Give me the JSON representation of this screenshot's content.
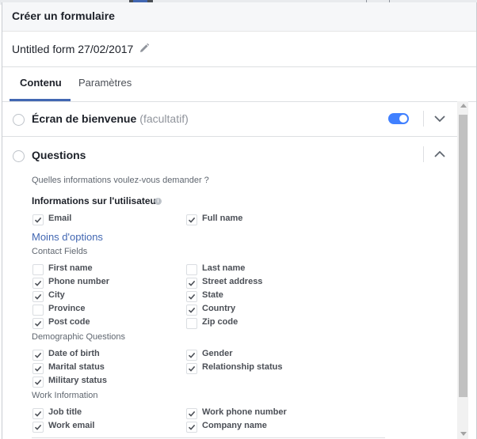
{
  "header": {
    "title": "Créer un formulaire"
  },
  "form": {
    "name": "Untitled form 27/02/2017"
  },
  "tabs": [
    {
      "label": "Contenu",
      "active": true
    },
    {
      "label": "Paramètres",
      "active": false
    }
  ],
  "welcome": {
    "title": "Écran de bienvenue",
    "optional": "(facultatif)",
    "toggle_on": true
  },
  "questions": {
    "title": "Questions",
    "prompt": "Quelles informations voulez-vous demander ?",
    "user_info_label": "Informations sur l'utilisateur",
    "less_options": "Moins d'options",
    "primary": [
      {
        "label": "Email",
        "checked": true
      },
      {
        "label": "Full name",
        "checked": true
      }
    ],
    "groups": [
      {
        "title": "Contact Fields",
        "fields": [
          {
            "label": "First name",
            "checked": false
          },
          {
            "label": "Last name",
            "checked": false
          },
          {
            "label": "Phone number",
            "checked": true
          },
          {
            "label": "Street address",
            "checked": true
          },
          {
            "label": "City",
            "checked": true
          },
          {
            "label": "State",
            "checked": true
          },
          {
            "label": "Province",
            "checked": false
          },
          {
            "label": "Country",
            "checked": true
          },
          {
            "label": "Post code",
            "checked": true
          },
          {
            "label": "Zip code",
            "checked": false
          }
        ]
      },
      {
        "title": "Demographic Questions",
        "fields": [
          {
            "label": "Date of birth",
            "checked": true
          },
          {
            "label": "Gender",
            "checked": true
          },
          {
            "label": "Marital status",
            "checked": true
          },
          {
            "label": "Relationship status",
            "checked": true
          },
          {
            "label": "Military status",
            "checked": true
          }
        ]
      },
      {
        "title": "Work Information",
        "fields": [
          {
            "label": "Job title",
            "checked": true
          },
          {
            "label": "Work phone number",
            "checked": true
          },
          {
            "label": "Work email",
            "checked": true
          },
          {
            "label": "Company name",
            "checked": true
          }
        ]
      }
    ]
  },
  "colors": {
    "accent": "#4267b2",
    "toggle": "#4080ff",
    "header_bg": "#f6f7f9"
  },
  "icons": {
    "edit": "pencil-icon",
    "info": "info-icon",
    "collapse": "chevron-up-icon",
    "expand": "chevron-down-icon"
  }
}
